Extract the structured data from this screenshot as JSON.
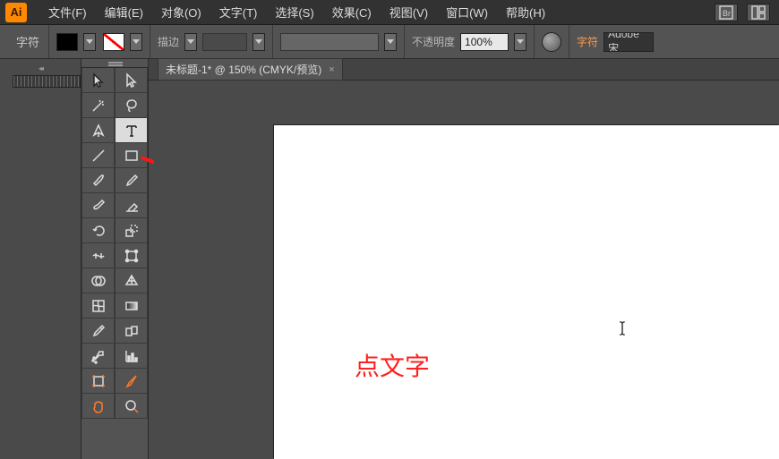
{
  "app": {
    "logo": "Ai"
  },
  "menu": {
    "file": "文件(F)",
    "edit": "编辑(E)",
    "object": "对象(O)",
    "type": "文字(T)",
    "select": "选择(S)",
    "effect": "效果(C)",
    "view": "视图(V)",
    "window": "窗口(W)",
    "help": "帮助(H)"
  },
  "controlbar": {
    "panel_label": "字符",
    "stroke_label": "描边",
    "opacity_label": "不透明度",
    "opacity_value": "100%",
    "char_panel": "字符",
    "font_name": "Adobe 宋"
  },
  "tab": {
    "title": "未标题-1* @ 150% (CMYK/预览)"
  },
  "tools": {
    "selection": "selection-tool",
    "direct_selection": "direct-selection-tool",
    "magic_wand": "magic-wand-tool",
    "lasso": "lasso-tool",
    "pen": "pen-tool",
    "type": "type-tool",
    "line": "line-segment-tool",
    "rectangle": "rectangle-tool",
    "paintbrush": "paintbrush-tool",
    "pencil": "pencil-tool",
    "blob_brush": "blob-brush-tool",
    "eraser": "eraser-tool",
    "rotate": "rotate-tool",
    "scale": "scale-tool",
    "width": "width-tool",
    "free_transform": "free-transform-tool",
    "shape_builder": "shape-builder-tool",
    "perspective": "perspective-grid-tool",
    "mesh": "mesh-tool",
    "gradient": "gradient-tool",
    "eyedropper": "eyedropper-tool",
    "blend": "blend-tool",
    "symbol_sprayer": "symbol-sprayer-tool",
    "column_graph": "column-graph-tool",
    "artboard": "artboard-tool",
    "slice": "slice-tool",
    "hand": "hand-tool",
    "zoom": "zoom-tool"
  },
  "annotation": {
    "text": "点文字",
    "cursor_glyph": "I"
  }
}
